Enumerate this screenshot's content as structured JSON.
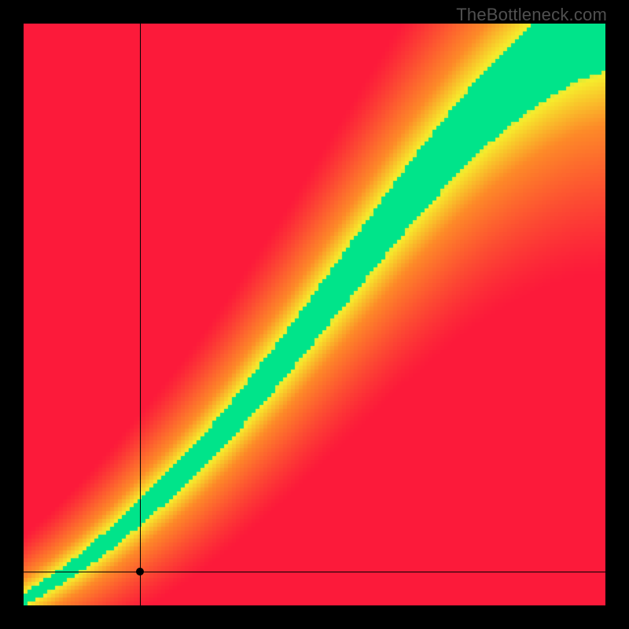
{
  "watermark": "TheBottleneck.com",
  "colors": {
    "red": "#fc1a3a",
    "orange": "#fd8a28",
    "yellow": "#f6ed2c",
    "green": "#00e48a",
    "black": "#000000",
    "gray": "#505050"
  },
  "layout": {
    "image_size": 800,
    "border": 30,
    "plot_size": 740
  },
  "crosshair": {
    "x_frac": 0.2,
    "y_frac": 0.058
  },
  "chart_data": {
    "type": "heatmap",
    "title": "",
    "xlabel": "",
    "ylabel": "",
    "xlim": [
      0,
      1
    ],
    "ylim": [
      0,
      1
    ],
    "legend": false,
    "description": "Compatibility heatmap with a green optimal band along a rising diagonal; red = worst, green = best, yellow/orange in between.",
    "optimal_band": {
      "comment": "Green band center y(x) and half-width w(x), both as fractions of plot height. Color saturates to green within band, fades through yellow/orange to red with distance.",
      "samples": [
        {
          "x": 0.0,
          "y": 0.01,
          "w": 0.01
        },
        {
          "x": 0.05,
          "y": 0.04,
          "w": 0.013
        },
        {
          "x": 0.1,
          "y": 0.075,
          "w": 0.016
        },
        {
          "x": 0.15,
          "y": 0.115,
          "w": 0.019
        },
        {
          "x": 0.2,
          "y": 0.16,
          "w": 0.022
        },
        {
          "x": 0.25,
          "y": 0.205,
          "w": 0.025
        },
        {
          "x": 0.3,
          "y": 0.255,
          "w": 0.028
        },
        {
          "x": 0.35,
          "y": 0.31,
          "w": 0.031
        },
        {
          "x": 0.4,
          "y": 0.37,
          "w": 0.035
        },
        {
          "x": 0.45,
          "y": 0.43,
          "w": 0.038
        },
        {
          "x": 0.5,
          "y": 0.495,
          "w": 0.042
        },
        {
          "x": 0.55,
          "y": 0.56,
          "w": 0.046
        },
        {
          "x": 0.6,
          "y": 0.625,
          "w": 0.05
        },
        {
          "x": 0.65,
          "y": 0.69,
          "w": 0.054
        },
        {
          "x": 0.7,
          "y": 0.75,
          "w": 0.058
        },
        {
          "x": 0.75,
          "y": 0.808,
          "w": 0.062
        },
        {
          "x": 0.8,
          "y": 0.86,
          "w": 0.066
        },
        {
          "x": 0.85,
          "y": 0.905,
          "w": 0.07
        },
        {
          "x": 0.9,
          "y": 0.945,
          "w": 0.074
        },
        {
          "x": 0.95,
          "y": 0.978,
          "w": 0.078
        },
        {
          "x": 1.0,
          "y": 1.0,
          "w": 0.082
        }
      ]
    },
    "marker": {
      "x": 0.2,
      "y": 0.058,
      "note": "Black dot with crosshair lines extending to axes"
    },
    "color_scale": [
      {
        "t": 0.0,
        "color": "#fc1a3a"
      },
      {
        "t": 0.55,
        "color": "#fd8a28"
      },
      {
        "t": 0.8,
        "color": "#f6ed2c"
      },
      {
        "t": 1.0,
        "color": "#00e48a"
      }
    ]
  }
}
